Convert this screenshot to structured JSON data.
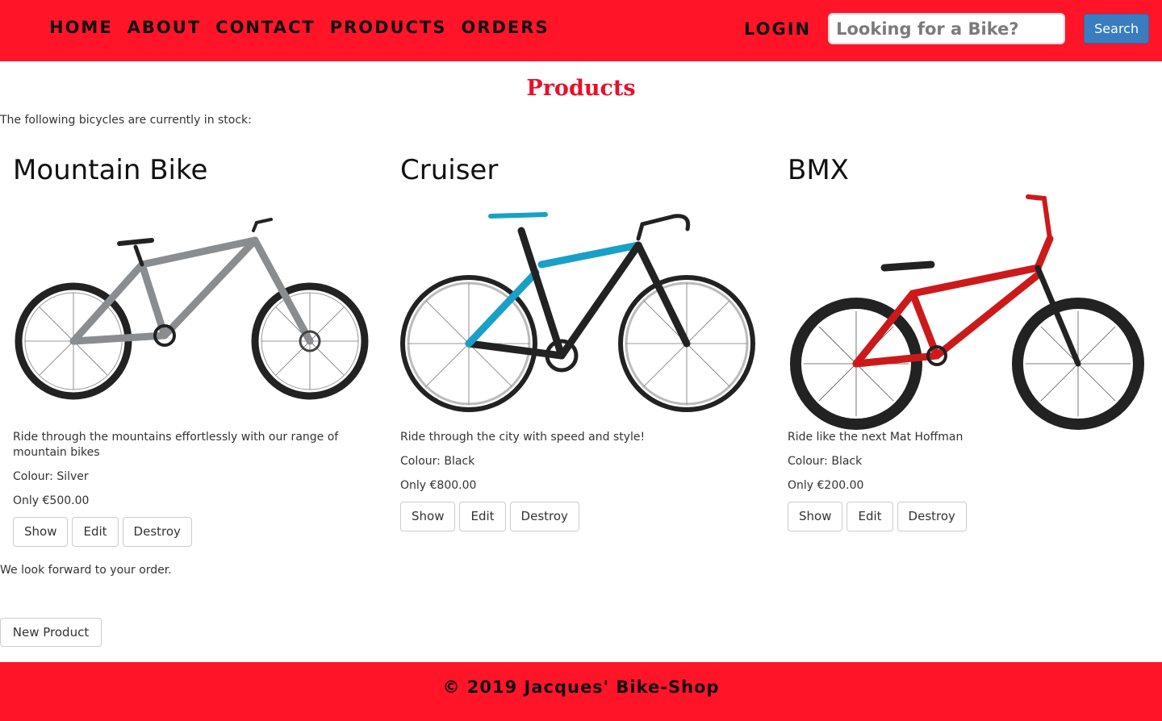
{
  "nav": {
    "links": [
      "HOME",
      "ABOUT",
      "CONTACT",
      "PRODUCTS",
      "ORDERS"
    ],
    "login_label": "LOGIN",
    "search_placeholder": "Looking for a Bike?",
    "search_button_label": "Search",
    "bar_color": "#ff1428"
  },
  "main": {
    "title": "Products",
    "intro": "The following bicycles are currently in stock:",
    "products": [
      {
        "name": "Mountain Bike",
        "image_icon": "mountain-bike-image",
        "frame_color": "#8a8d90",
        "description": "Ride through the mountains effortlessly with our range of mountain bikes",
        "colour": "Colour: Silver",
        "price": "Only €500.00",
        "actions": [
          "Show",
          "Edit",
          "Destroy"
        ]
      },
      {
        "name": "Cruiser",
        "image_icon": "road-bike-image",
        "frame_color": "#1f1f1f",
        "description": "Ride through the city with speed and style!",
        "colour": "Colour: Black",
        "price": "Only €800.00",
        "actions": [
          "Show",
          "Edit",
          "Destroy"
        ]
      },
      {
        "name": "BMX",
        "image_icon": "bmx-bike-image",
        "frame_color": "#cc1a1a",
        "description": "Ride like the next Mat Hoffman",
        "colour": "Colour: Black",
        "price": "Only €200.00",
        "actions": [
          "Show",
          "Edit",
          "Destroy"
        ]
      }
    ],
    "outro": "We look forward to your order.",
    "new_product_label": "New Product"
  },
  "footer": {
    "text": "© 2019 Jacques' Bike-Shop"
  }
}
